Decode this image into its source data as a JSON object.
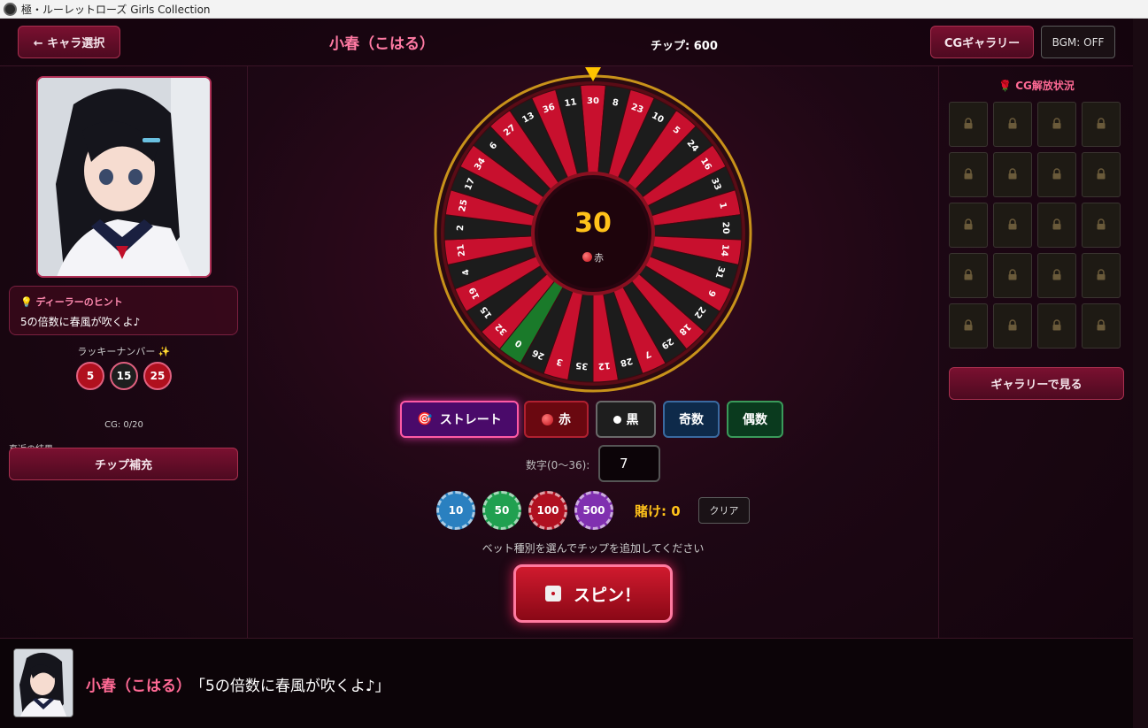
{
  "window": {
    "title": "極・ルーレットローズ Girls Collection"
  },
  "header": {
    "back_label": "← キャラ選択",
    "character_name": "小春（こはる）",
    "chips": "チップ: 600",
    "cg_gallery_label": "CGギャラリー",
    "bgm_label": "BGM: OFF"
  },
  "left": {
    "hint_title": "ディーラーのヒント",
    "hint_text": "5の倍数に春風が吹くよ♪",
    "lucky_label": "ラッキーナンバー ✨",
    "lucky_numbers": [
      "5",
      "15",
      "25"
    ],
    "cg_count": "CG: 0/20",
    "recent_label": "直近の結果",
    "refill_label": "チップ補充"
  },
  "right": {
    "cg_status_title": "CG解放状況",
    "view_gallery_label": "ギャラリーで見る",
    "locked_cells": 20
  },
  "wheel": {
    "sequence": [
      30,
      8,
      23,
      10,
      5,
      24,
      16,
      33,
      1,
      20,
      14,
      31,
      9,
      22,
      18,
      29,
      7,
      28,
      12,
      35,
      3,
      26,
      0,
      32,
      15,
      19,
      4,
      21,
      2,
      25,
      17,
      34,
      6,
      27,
      13,
      36,
      11
    ],
    "red_numbers": [
      1,
      3,
      5,
      7,
      9,
      12,
      14,
      16,
      18,
      19,
      21,
      23,
      25,
      27,
      30,
      32,
      34,
      36
    ],
    "result_number": "30",
    "result_color": "赤",
    "colors": {
      "red": "#c8102e",
      "black": "#1c1c1c",
      "green": "#1a7a2a",
      "rim": "#c8921a"
    }
  },
  "bet": {
    "types": [
      "ストレート",
      "赤",
      "黒",
      "奇数",
      "偶数"
    ],
    "number_label": "数字(0〜36):",
    "number_value": "7",
    "chips": [
      "10",
      "50",
      "100",
      "500"
    ],
    "bet_amount": "賭け: 0",
    "clear_label": "クリア",
    "instruction": "ベット種別を選んでチップを追加してください",
    "spin_label": "スピン！"
  },
  "dialogue": {
    "name": "小春（こはる）",
    "text": "「5の倍数に春風が吹くよ♪」"
  }
}
